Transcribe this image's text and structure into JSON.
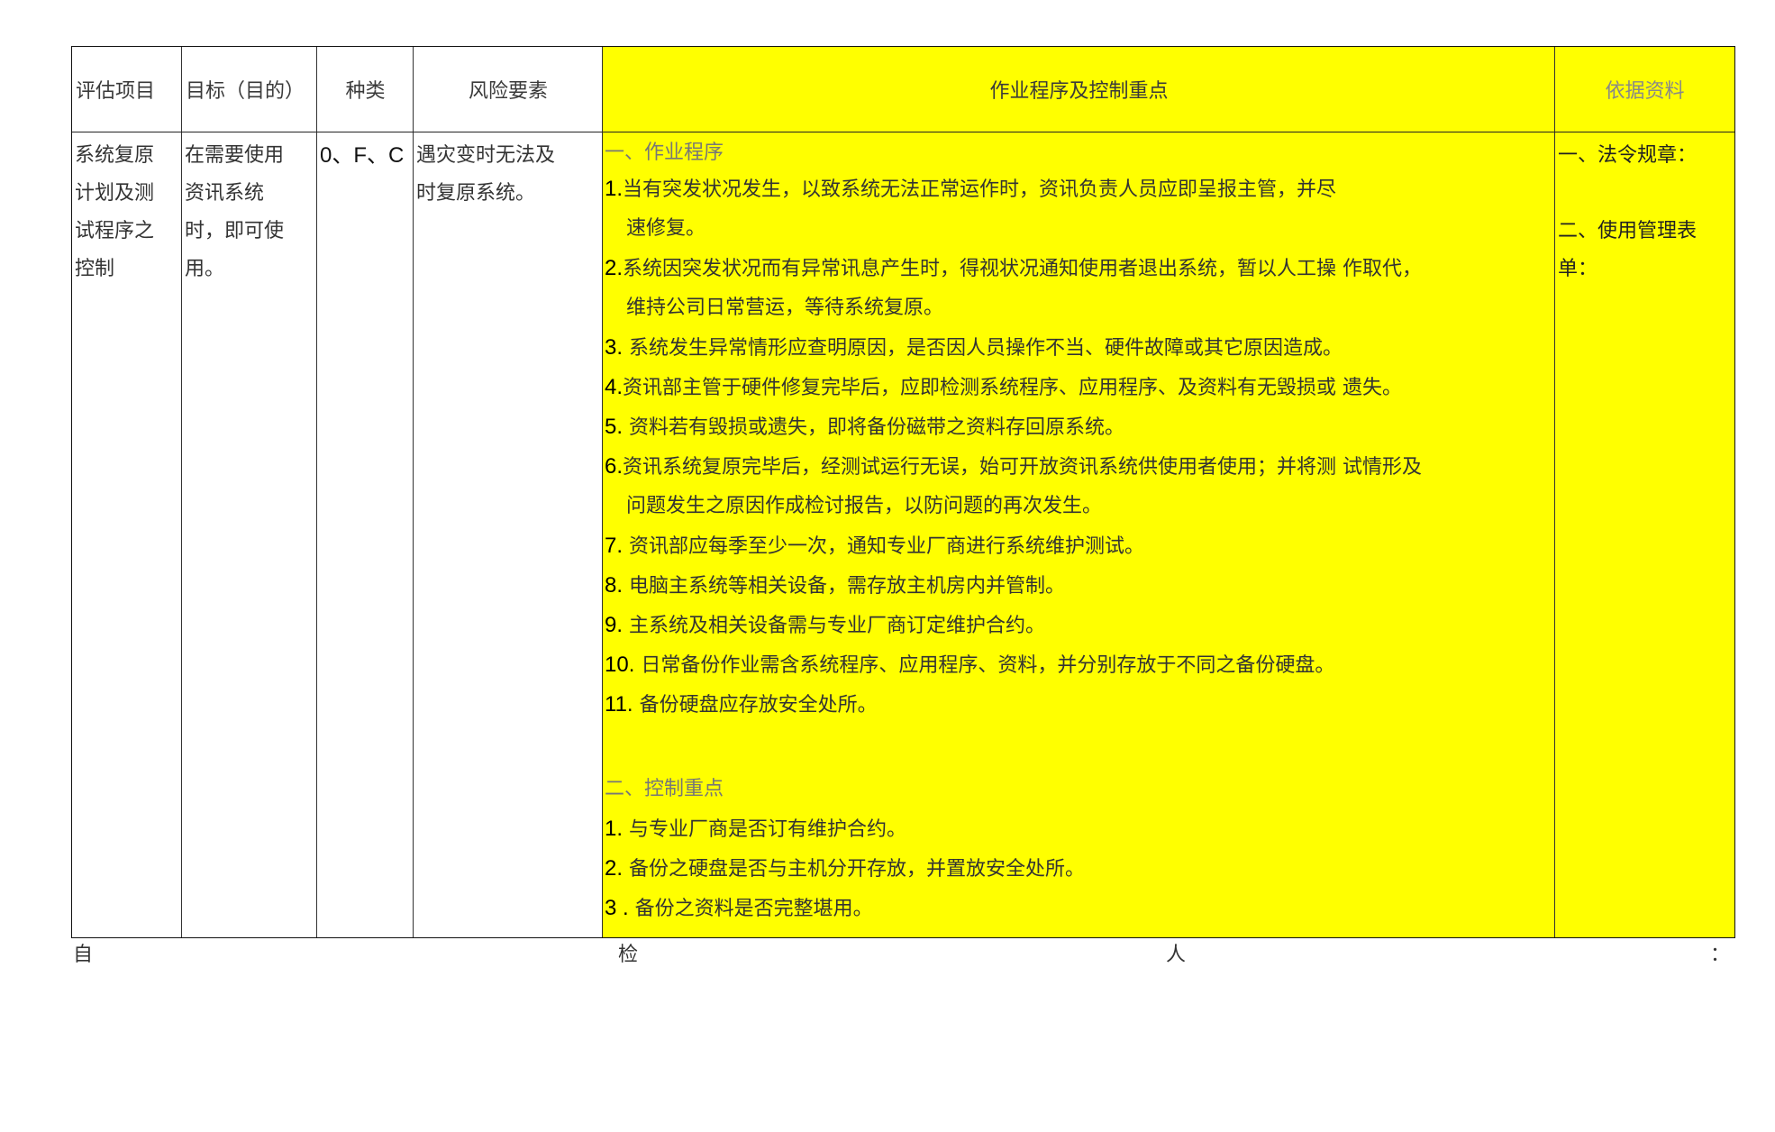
{
  "table": {
    "headers": {
      "item": "评估项目",
      "objective": "目标（目的）",
      "category": "种类",
      "risk": "风险要素",
      "procedure": "作业程序及控制重点",
      "reference": "依据资料"
    },
    "row": {
      "item_lines": [
        "系统复原",
        "计划及测",
        "试程序之",
        "控制"
      ],
      "objective_lines": [
        "在需要使用",
        "资讯系统",
        "时，即可使",
        "用。"
      ],
      "category": "0、F、C",
      "risk_lines": [
        "遇灾变时无法及",
        "时复原系统。"
      ],
      "procedure": {
        "section1_title": "一、作业程序",
        "steps": [
          {
            "num": "1.",
            "lines": [
              "当有突发状况发生，以致系统无法正常运作时，资讯负责人员应即呈报主管，并尽",
              "速修复。"
            ]
          },
          {
            "num": "2.",
            "lines": [
              "系统因突发状况而有异常讯息产生时，得视状况通知使用者退出系统，暂以人工操 作取代，",
              "维持公司日常营运，等待系统复原。"
            ]
          },
          {
            "num": "3.",
            "lines": [
              " 系统发生异常情形应查明原因，是否因人员操作不当、硬件故障或其它原因造成。"
            ]
          },
          {
            "num": "4.",
            "lines": [
              "资讯部主管于硬件修复完毕后，应即检测系统程序、应用程序、及资料有无毁损或 遗失。"
            ]
          },
          {
            "num": "5.",
            "lines": [
              " 资料若有毁损或遗失，即将备份磁带之资料存回原系统。"
            ]
          },
          {
            "num": "6.",
            "lines": [
              "资讯系统复原完毕后，经测试运行无误，始可开放资讯系统供使用者使用；并将测 试情形及",
              "问题发生之原因作成检讨报告，以防问题的再次发生。"
            ]
          },
          {
            "num": "7.",
            "lines": [
              " 资讯部应每季至少一次，通知专业厂商进行系统维护测试。"
            ]
          },
          {
            "num": "8.",
            "lines": [
              " 电脑主系统等相关设备，需存放主机房内并管制。"
            ]
          },
          {
            "num": "9.",
            "lines": [
              " 主系统及相关设备需与专业厂商订定维护合约。"
            ]
          },
          {
            "num": "10.",
            "lines": [
              " 日常备份作业需含系统程序、应用程序、资料，并分别存放于不同之备份硬盘。"
            ]
          },
          {
            "num": "11.",
            "lines": [
              " 备份硬盘应存放安全处所。"
            ]
          }
        ],
        "section2_title": "二、控制重点",
        "controls": [
          {
            "num": "1.",
            "text": " 与专业厂商是否订有维护合约。"
          },
          {
            "num": "2.",
            "text": " 备份之硬盘是否与主机分开存放，并置放安全处所。"
          },
          {
            "num": "3 .",
            "text": " 备份之资料是否完整堪用。"
          }
        ]
      },
      "reference": {
        "line1": "一、法令规章：",
        "line2": "二、使用管理表",
        "line3": "单："
      }
    }
  },
  "footer": {
    "c1": "自",
    "c2": "检",
    "c3": "人",
    "c4": "："
  },
  "colors": {
    "highlight": "#ffff00"
  }
}
